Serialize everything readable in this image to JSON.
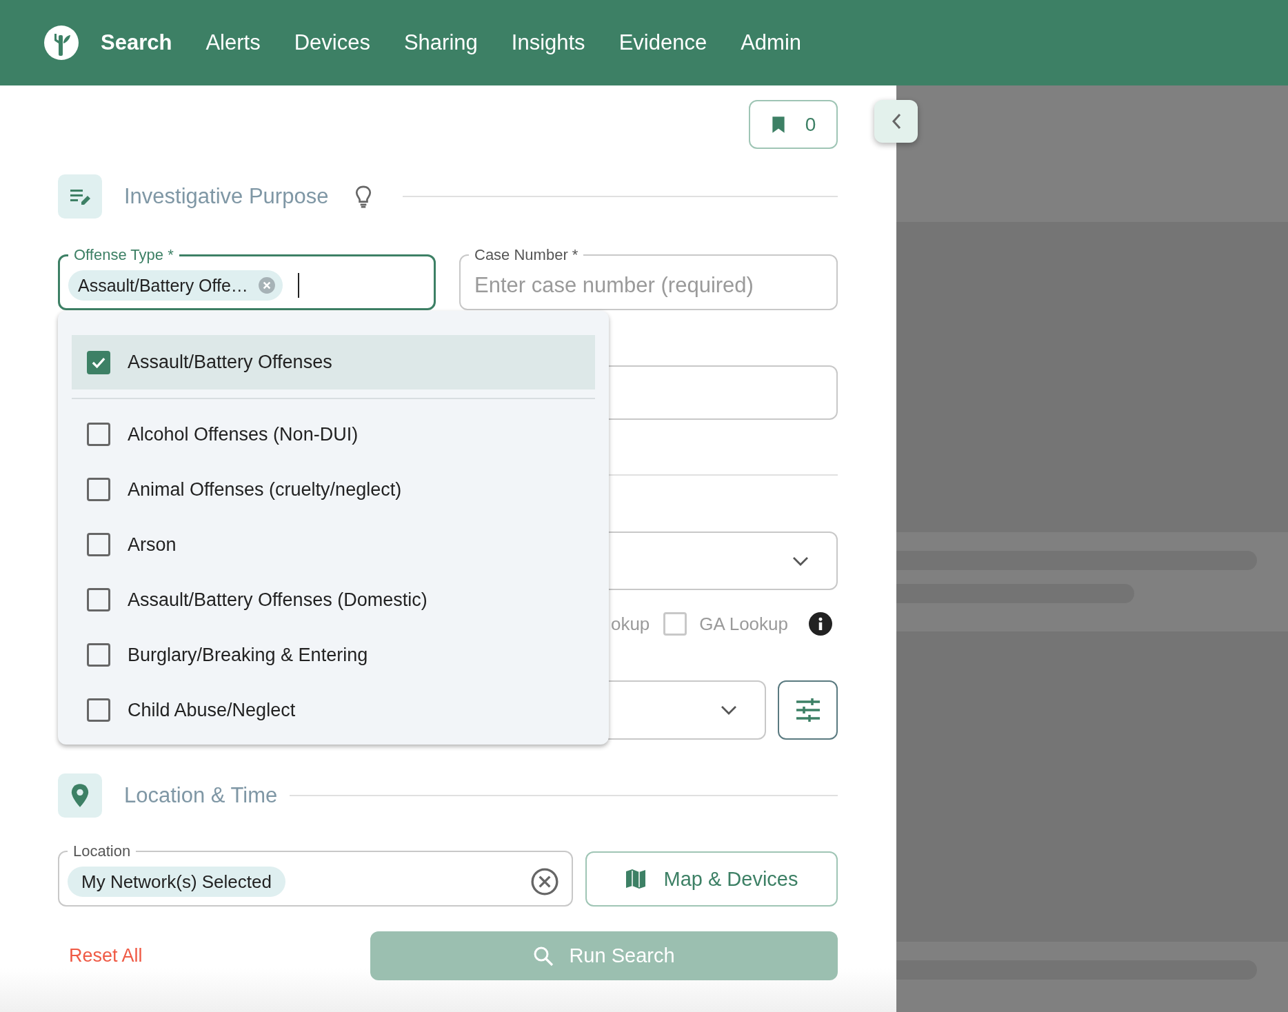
{
  "nav": {
    "items": [
      {
        "label": "Search",
        "selected": true
      },
      {
        "label": "Alerts",
        "selected": false
      },
      {
        "label": "Devices",
        "selected": false
      },
      {
        "label": "Sharing",
        "selected": false
      },
      {
        "label": "Insights",
        "selected": false
      },
      {
        "label": "Evidence",
        "selected": false
      },
      {
        "label": "Admin",
        "selected": false
      }
    ]
  },
  "bookmarks": {
    "count": "0"
  },
  "purpose": {
    "title": "Investigative Purpose"
  },
  "offense_type": {
    "label": "Offense Type *",
    "chip": "Assault/Battery Offe…",
    "focused": true
  },
  "case_number": {
    "label": "Case Number *",
    "placeholder": "Enter case number (required)"
  },
  "dropdown": {
    "options": [
      {
        "label": "Assault/Battery Offenses",
        "checked": true,
        "selected": true
      },
      {
        "label": "Alcohol Offenses (Non-DUI)",
        "checked": false,
        "selected": false
      },
      {
        "label": "Animal Offenses (cruelty/neglect)",
        "checked": false,
        "selected": false
      },
      {
        "label": "Arson",
        "checked": false,
        "selected": false
      },
      {
        "label": "Assault/Battery Offenses (Domestic)",
        "checked": false,
        "selected": false
      },
      {
        "label": "Burglary/Breaking & Entering",
        "checked": false,
        "selected": false
      },
      {
        "label": "Child Abuse/Neglect",
        "checked": false,
        "selected": false
      }
    ]
  },
  "lookup_partial": "okup",
  "ga_lookup": {
    "label": "GA Lookup",
    "checked": false
  },
  "location_time": {
    "title": "Location & Time"
  },
  "location": {
    "label": "Location",
    "chip": "My Network(s) Selected"
  },
  "map_button": "Map & Devices",
  "reset": "Reset All",
  "run_search": {
    "label": "Run Search",
    "disabled": true
  }
}
